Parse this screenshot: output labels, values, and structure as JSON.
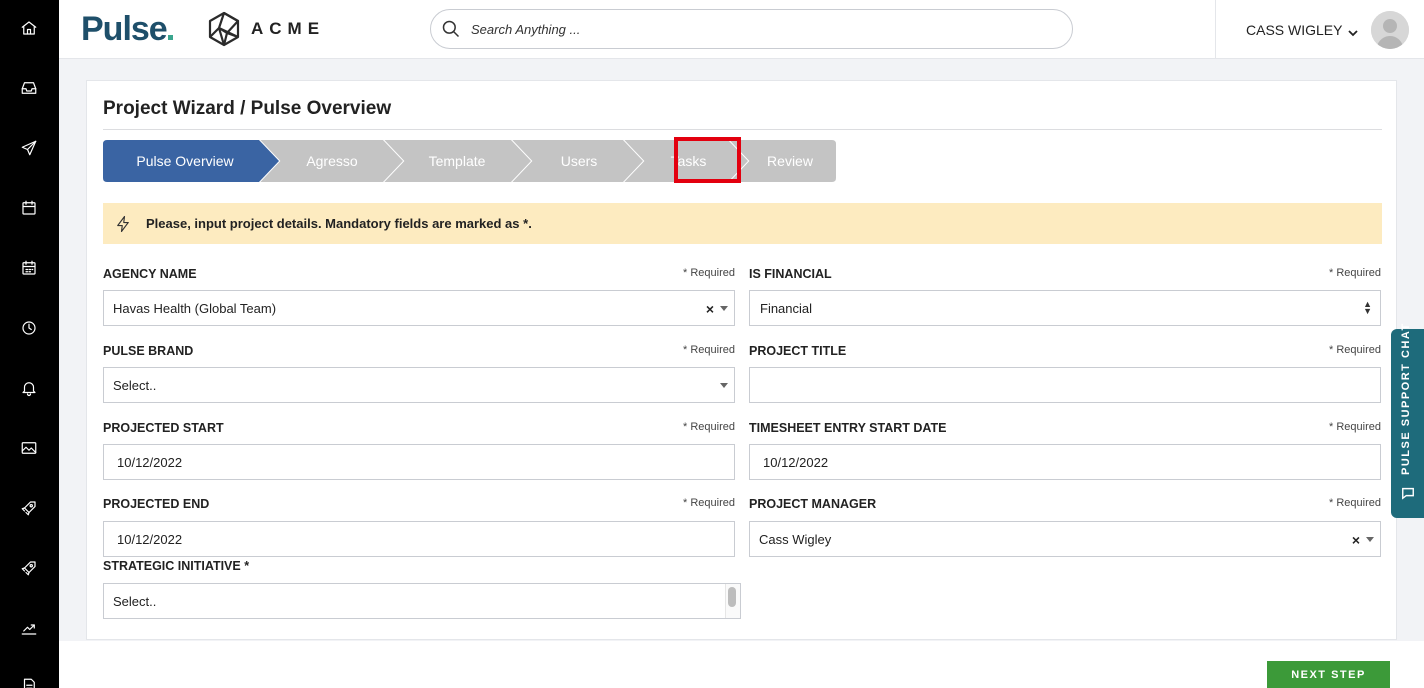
{
  "header": {
    "brand_logo": "Pulse",
    "client_logo": "ACME",
    "search_placeholder": "Search Anything ...",
    "user_name": "CASS WIGLEY"
  },
  "page": {
    "title": "Project Wizard / Pulse Overview"
  },
  "wizard": {
    "steps": [
      "Pulse Overview",
      "Agresso",
      "Template",
      "Users",
      "Tasks",
      "Review"
    ],
    "active_step": "Pulse Overview",
    "highlighted_step": "Tasks",
    "active_color": "#3a64a3",
    "inactive_color": "#c4c4c4",
    "highlight_color": "#e3000f"
  },
  "notice": {
    "text": "Please, input project details. Mandatory fields are marked as *.",
    "background": "#fdebc0"
  },
  "form": {
    "required_text": "* Required",
    "agency_name": {
      "label": "AGENCY NAME",
      "value": "Havas Health (Global Team)"
    },
    "is_financial": {
      "label": "IS FINANCIAL",
      "value": "Financial"
    },
    "pulse_brand": {
      "label": "PULSE BRAND",
      "value": "Select.."
    },
    "project_title": {
      "label": "PROJECT TITLE",
      "value": ""
    },
    "projected_start": {
      "label": "PROJECTED START",
      "value": "10/12/2022"
    },
    "timesheet_start": {
      "label": "TIMESHEET ENTRY START DATE",
      "value": "10/12/2022"
    },
    "projected_end": {
      "label": "PROJECTED END",
      "value": "10/12/2022"
    },
    "project_manager": {
      "label": "PROJECT MANAGER",
      "value": "Cass Wigley"
    },
    "strategic_initiative": {
      "label": "STRATEGIC INITIATIVE *",
      "value": "Select.."
    }
  },
  "footer": {
    "next_label": "NEXT STEP",
    "next_color": "#3c9a39"
  },
  "support_chat": {
    "label": "PULSE SUPPORT CHAT",
    "color": "#1e6b7b"
  },
  "sidebar_icons": [
    "home-icon",
    "inbox-icon",
    "send-icon",
    "calendar-icon",
    "calendar-grid-icon",
    "clock-icon",
    "bell-icon",
    "image-icon",
    "rocket-icon",
    "rocket-alt-icon",
    "trend-chart-icon",
    "document-icon"
  ]
}
